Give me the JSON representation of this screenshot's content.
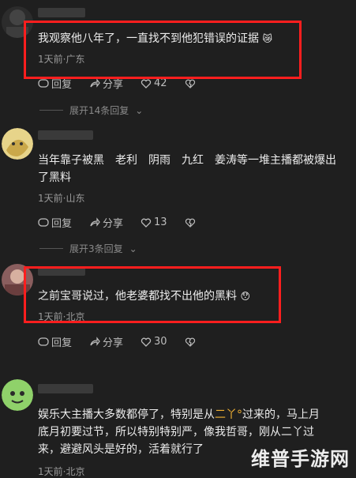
{
  "comments": [
    {
      "text": "我观察他八年了，一直找不到他犯错误的证据",
      "meta": "1天前·广东",
      "reply": "回复",
      "share": "分享",
      "likes": "42",
      "expand": "展开14条回复"
    },
    {
      "text_line1": "当年靠子被黑　老利　阴雨　九红　姜涛等一堆主播都被爆出",
      "text_line2": "了黑料",
      "meta": "1天前·山东",
      "reply": "回复",
      "share": "分享",
      "likes": "13",
      "expand": "展开3条回复"
    },
    {
      "text": "之前宝哥说过，他老婆都找不出他的黑料",
      "meta": "1天前·北京",
      "reply": "回复",
      "share": "分享",
      "likes": "30"
    },
    {
      "text_line1_a": "娱乐大主播大多数都停了，特别是从",
      "text_line1_hl": "二丫°",
      "text_line1_b": "过来的，马上月",
      "text_line2": "底月初要过节，所以特别特别严，像我哲哥，刚从二丫过",
      "text_line3": "来，避避风头是好的，活着就行了",
      "meta": "1天前·北京"
    }
  ],
  "watermark": "维普手游网",
  "colors": {
    "background": "#1f1f1f",
    "highlight_box": "#ff1e1e",
    "mention": "#f2b233"
  }
}
